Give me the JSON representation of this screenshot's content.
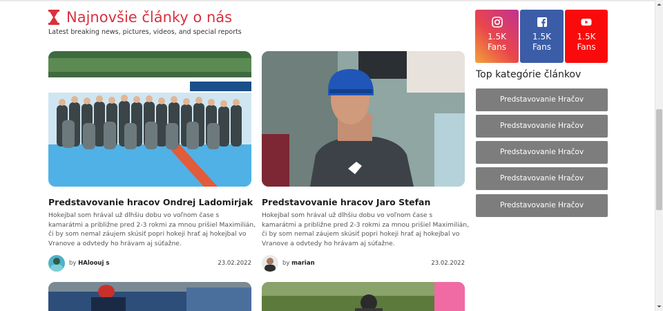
{
  "section": {
    "title": "Najnovšie články o nás",
    "subtitle": "Latest breaking news, pictures, videos, and special reports"
  },
  "articles": [
    {
      "title": "Predstavovanie hracov Ondrej Ladomirjak",
      "excerpt": "Hokejbal som hrával už dlhšiu dobu vo voľnom čase s kamarátmi a približne pred 2-3 rokmi za mnou prišiel Maximilián, či by som nemal záujem skúsiť popri hokeji hrať aj hokejbal vo Vranove a odvtedy ho hrávam aj súťažne.",
      "by": "by",
      "author": "HAloouj s",
      "date": "23.02.2022"
    },
    {
      "title": "Predstavovanie hracov Jaro Stefan",
      "excerpt": "Hokejbal som hrával už dlhšiu dobu vo voľnom čase s kamarátmi a približne pred 2-3 rokmi za mnou prišiel Maximilián, či by som nemal záujem skúsiť popri hokeji hrať aj hokejbal vo Vranove a odvtedy ho hrávam aj súťažne.",
      "by": "by",
      "author": "marian",
      "date": "23.02.2022"
    }
  ],
  "social": [
    {
      "icon": "instagram-icon",
      "count": "1.5K",
      "label": "Fans",
      "color": "#e1306c"
    },
    {
      "icon": "facebook-icon",
      "count": "1.5K",
      "label": "Fans",
      "color": "#3b5da8"
    },
    {
      "icon": "youtube-icon",
      "count": "1.5K",
      "label": "Fans",
      "color": "#fa0b0b"
    }
  ],
  "categories": {
    "title": "Top kategórie článkov",
    "items": [
      "Predstavovanie Hračov",
      "Predstavovanie Hračov",
      "Predstavovanie Hračov",
      "Predstavovanie Hračov",
      "Predstavovanie Hračov"
    ]
  },
  "colors": {
    "accent": "#d8313f",
    "category_button": "#7d7d7d"
  }
}
